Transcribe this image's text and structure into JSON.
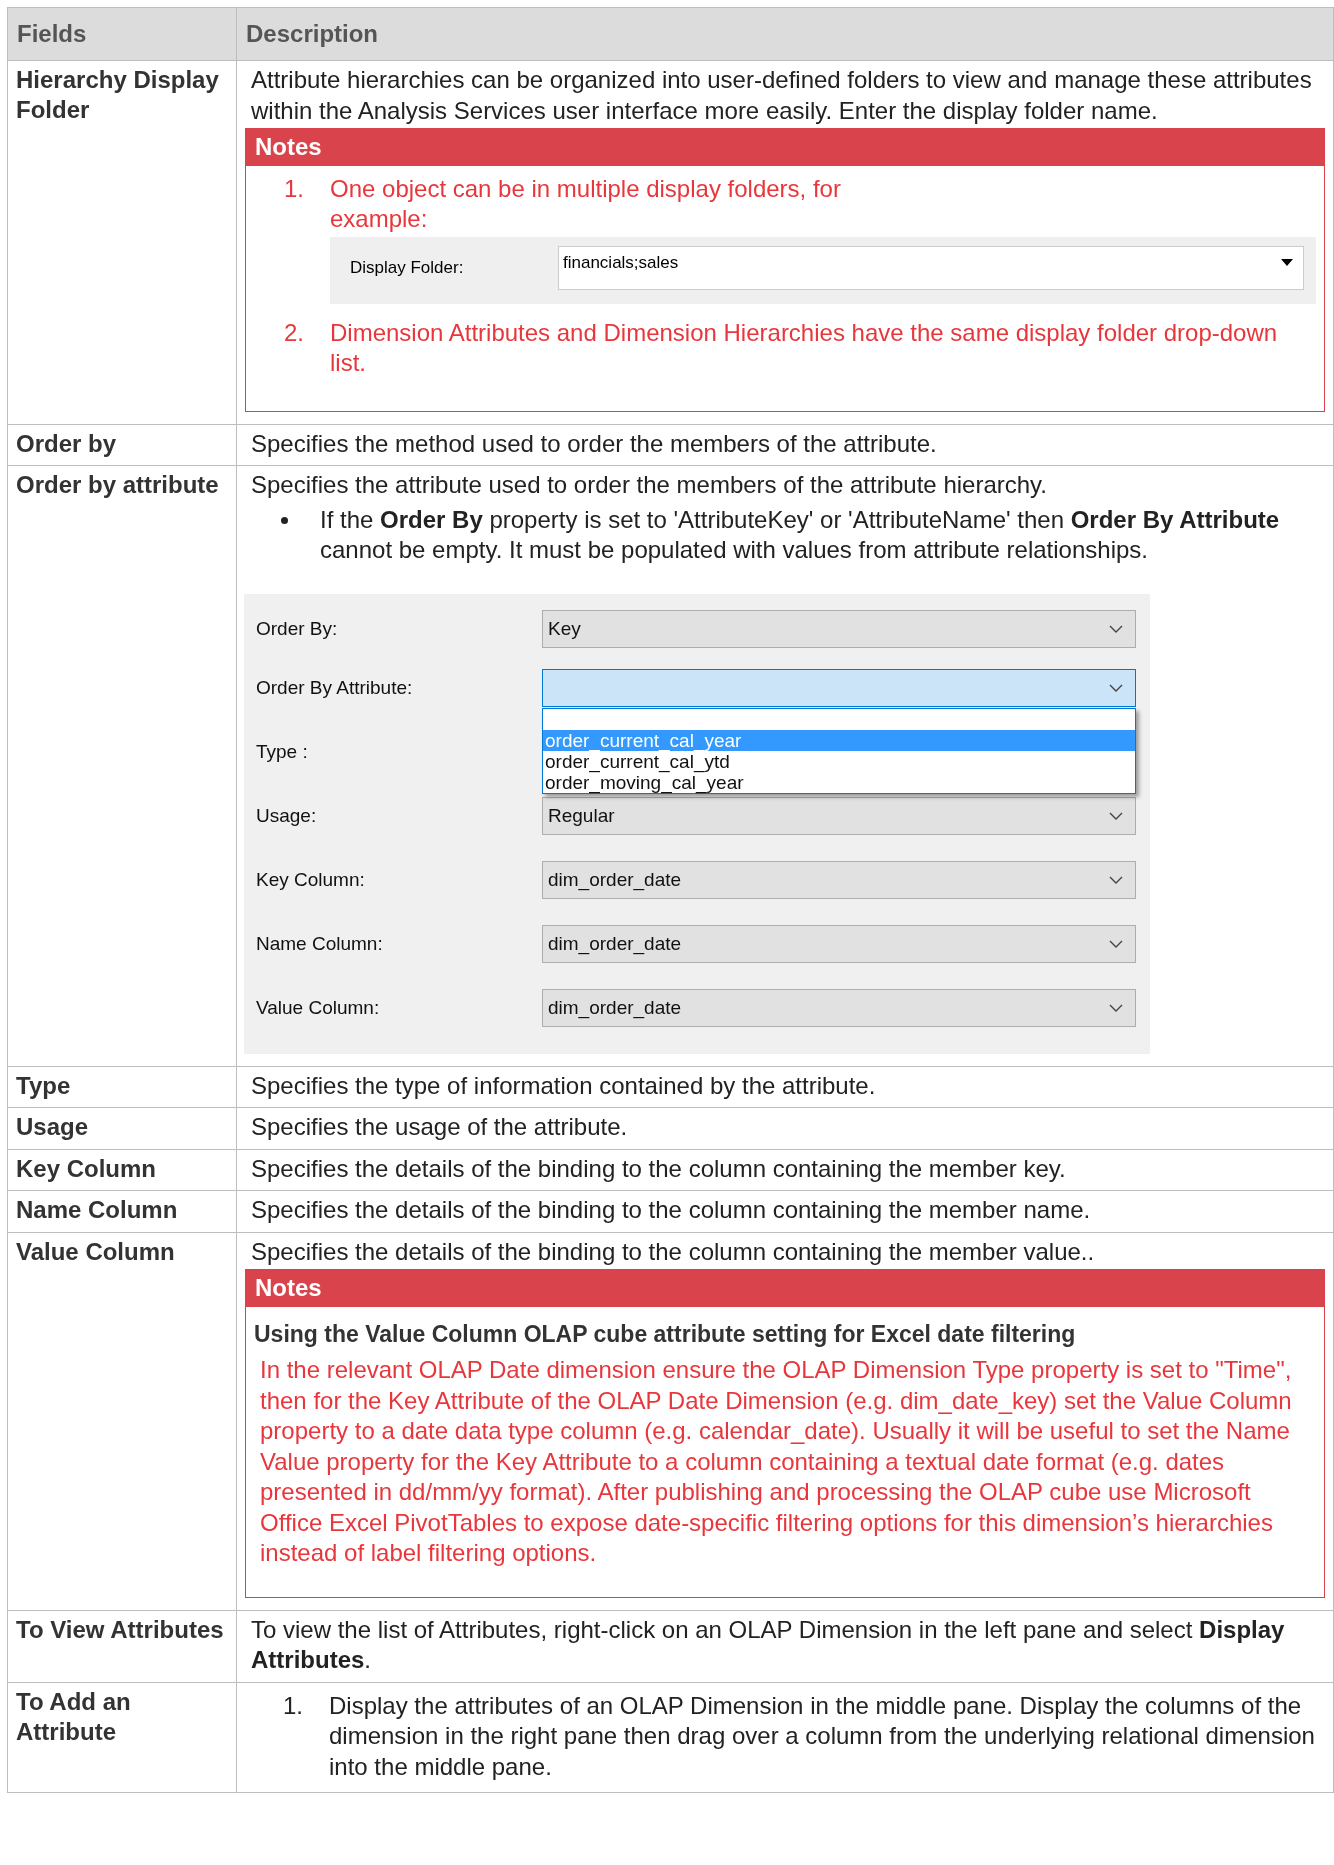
{
  "table": {
    "columns": [
      "Fields",
      "Description"
    ],
    "rows": [
      {
        "field": "Hierarchy Display Folder",
        "content": [
          {
            "kind": "paragraph",
            "text": "Attribute hierarchies can be organized into user-defined folders to view and manage these attributes within the Analysis Services user interface more easily. Enter the display folder name."
          },
          {
            "kind": "notes",
            "title": "Notes",
            "items": [
              {
                "kind": "numbered",
                "number": "1.",
                "text": "One object can be in multiple display folders, for example:",
                "form": {
                  "label": "Display Folder:",
                  "value": "financials;sales"
                }
              },
              {
                "kind": "numbered",
                "number": "2.",
                "text": "Dimension Attributes and Dimension Hierarchies have the same display folder drop-down list."
              }
            ]
          }
        ]
      },
      {
        "field": "Order by",
        "content": [
          {
            "kind": "paragraph",
            "text": "Specifies the method used to order the members of the attribute."
          }
        ]
      },
      {
        "field": "Order by attribute",
        "content": [
          {
            "kind": "paragraph",
            "text": "Specifies the attribute used to order the members of the attribute hierarchy."
          },
          {
            "kind": "bullet",
            "text": "If the **Order By** property is set to 'AttributeKey' or 'AttributeName' then **Order By Attribute** cannot be empty. It must be populated with values from attribute relationships."
          },
          {
            "kind": "dialog",
            "fields": [
              {
                "label": "Order By:",
                "value": "Key",
                "focused": false
              },
              {
                "label": "Order By Attribute:",
                "focused": true,
                "options": [
                  {
                    "text": "order_current_cal_year",
                    "selected": true
                  },
                  {
                    "text": "order_current_cal_ytd",
                    "selected": false
                  },
                  {
                    "text": "order_moving_cal_year",
                    "selected": false
                  }
                ]
              },
              {
                "label": "Type :"
              },
              {
                "label": "Usage:",
                "value": "Regular",
                "focused": false
              },
              {
                "label": "Key Column:",
                "value": "dim_order_date",
                "focused": false
              },
              {
                "label": "Name Column:",
                "value": "dim_order_date",
                "focused": false
              },
              {
                "label": "Value Column:",
                "value": "dim_order_date",
                "focused": false
              }
            ]
          }
        ]
      },
      {
        "field": "Type",
        "content": [
          {
            "kind": "paragraph",
            "text": "Specifies the type of information contained by the attribute."
          }
        ]
      },
      {
        "field": "Usage",
        "content": [
          {
            "kind": "paragraph",
            "text": "Specifies the usage of the attribute."
          }
        ]
      },
      {
        "field": "Key Column",
        "content": [
          {
            "kind": "paragraph",
            "text": "Specifies the details of the binding to the column containing the member key."
          }
        ]
      },
      {
        "field": "Name Column",
        "content": [
          {
            "kind": "paragraph",
            "text": "Specifies the details of the binding to the column containing the member name."
          }
        ]
      },
      {
        "field": "Value Column",
        "content": [
          {
            "kind": "paragraph",
            "text": "Specifies the details of the binding to the column containing the member value.."
          },
          {
            "kind": "notes",
            "title": "Notes",
            "items": [
              {
                "kind": "heading",
                "text": "Using the Value Column OLAP cube attribute setting for Excel date filtering"
              },
              {
                "kind": "paragraph",
                "text": "In the relevant OLAP Date dimension ensure the OLAP Dimension Type property is set to \"Time\", then for the Key Attribute of the OLAP Date Dimension (e.g. dim_date_key) set the Value Column property to a date data type column (e.g. calendar_date). Usually it will be useful to set the Name Value property for the Key Attribute to a column containing a textual date format (e.g. dates presented in dd/mm/yy format). After publishing and processing the OLAP cube use Microsoft Office Excel PivotTables to expose date-specific filtering options for this dimension’s hierarchies instead of label filtering options."
              }
            ]
          }
        ]
      },
      {
        "field": "To View Attributes",
        "content": [
          {
            "kind": "paragraph",
            "text": "To view the list of Attributes, right-click on an OLAP Dimension in the left pane and select **Display Attributes**."
          }
        ]
      },
      {
        "field": "To Add an Attribute",
        "content": [
          {
            "kind": "numbered",
            "number": "1.",
            "text": "Display the attributes of an OLAP Dimension in the middle pane. Display the columns of the dimension in the right pane then drag over a column from the underlying relational dimension into the middle pane."
          }
        ]
      }
    ]
  }
}
